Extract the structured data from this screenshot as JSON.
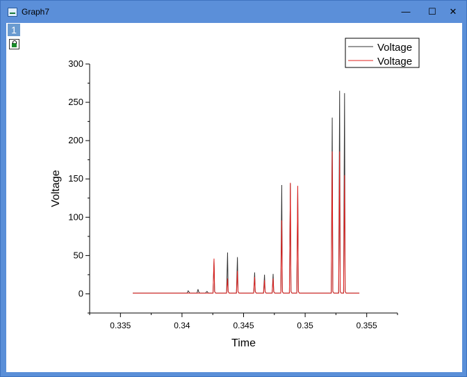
{
  "window": {
    "title": "Graph7",
    "layer_label": "1"
  },
  "controls": {
    "minimize": "—",
    "maximize": "☐",
    "close": "✕"
  },
  "chart_data": {
    "type": "line",
    "title": "",
    "xlabel": "Time",
    "ylabel": "Voltage",
    "xlim": [
      0.3325,
      0.3575
    ],
    "ylim": [
      -25,
      300
    ],
    "xticks": [
      "0.335",
      "0.34",
      "0.345",
      "0.35",
      "0.355"
    ],
    "yticks": [
      "0",
      "50",
      "100",
      "150",
      "200",
      "250",
      "300"
    ],
    "legend_position": "top-right",
    "grid": false,
    "series": [
      {
        "name": "Voltage",
        "color": "#333333",
        "baseline": 1,
        "x_range": [
          0.336,
          0.3544
        ],
        "peaks": [
          [
            0.3405,
            4
          ],
          [
            0.3413,
            6
          ],
          [
            0.342,
            3
          ],
          [
            0.3426,
            44
          ],
          [
            0.3437,
            54
          ],
          [
            0.3445,
            48
          ],
          [
            0.3459,
            28
          ],
          [
            0.3467,
            25
          ],
          [
            0.3474,
            26
          ],
          [
            0.3481,
            142
          ],
          [
            0.3488,
            144
          ],
          [
            0.3494,
            140
          ],
          [
            0.3522,
            230
          ],
          [
            0.3528,
            265
          ],
          [
            0.3532,
            262
          ]
        ]
      },
      {
        "name": "Voltage",
        "color": "#e0201e",
        "baseline": 1,
        "x_range": [
          0.336,
          0.3544
        ],
        "peaks": [
          [
            0.3426,
            46
          ],
          [
            0.3437,
            20
          ],
          [
            0.3445,
            30
          ],
          [
            0.3459,
            22
          ],
          [
            0.3467,
            18
          ],
          [
            0.3474,
            20
          ],
          [
            0.3481,
            96
          ],
          [
            0.3488,
            145
          ],
          [
            0.3494,
            141
          ],
          [
            0.3522,
            186
          ],
          [
            0.3528,
            186
          ],
          [
            0.3532,
            155
          ]
        ]
      }
    ]
  }
}
